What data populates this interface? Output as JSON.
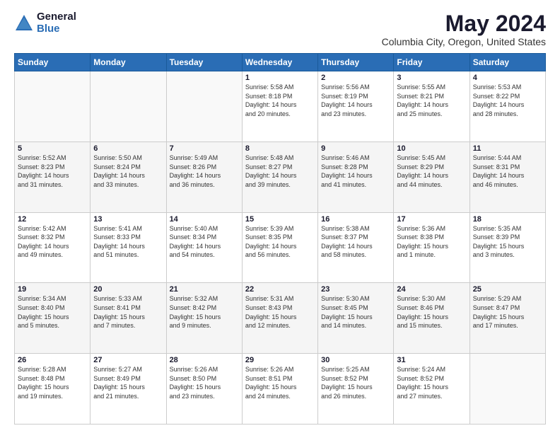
{
  "logo": {
    "general": "General",
    "blue": "Blue"
  },
  "title": "May 2024",
  "location": "Columbia City, Oregon, United States",
  "days_header": [
    "Sunday",
    "Monday",
    "Tuesday",
    "Wednesday",
    "Thursday",
    "Friday",
    "Saturday"
  ],
  "weeks": [
    [
      {
        "day": "",
        "info": ""
      },
      {
        "day": "",
        "info": ""
      },
      {
        "day": "",
        "info": ""
      },
      {
        "day": "1",
        "info": "Sunrise: 5:58 AM\nSunset: 8:18 PM\nDaylight: 14 hours\nand 20 minutes."
      },
      {
        "day": "2",
        "info": "Sunrise: 5:56 AM\nSunset: 8:19 PM\nDaylight: 14 hours\nand 23 minutes."
      },
      {
        "day": "3",
        "info": "Sunrise: 5:55 AM\nSunset: 8:21 PM\nDaylight: 14 hours\nand 25 minutes."
      },
      {
        "day": "4",
        "info": "Sunrise: 5:53 AM\nSunset: 8:22 PM\nDaylight: 14 hours\nand 28 minutes."
      }
    ],
    [
      {
        "day": "5",
        "info": "Sunrise: 5:52 AM\nSunset: 8:23 PM\nDaylight: 14 hours\nand 31 minutes."
      },
      {
        "day": "6",
        "info": "Sunrise: 5:50 AM\nSunset: 8:24 PM\nDaylight: 14 hours\nand 33 minutes."
      },
      {
        "day": "7",
        "info": "Sunrise: 5:49 AM\nSunset: 8:26 PM\nDaylight: 14 hours\nand 36 minutes."
      },
      {
        "day": "8",
        "info": "Sunrise: 5:48 AM\nSunset: 8:27 PM\nDaylight: 14 hours\nand 39 minutes."
      },
      {
        "day": "9",
        "info": "Sunrise: 5:46 AM\nSunset: 8:28 PM\nDaylight: 14 hours\nand 41 minutes."
      },
      {
        "day": "10",
        "info": "Sunrise: 5:45 AM\nSunset: 8:29 PM\nDaylight: 14 hours\nand 44 minutes."
      },
      {
        "day": "11",
        "info": "Sunrise: 5:44 AM\nSunset: 8:31 PM\nDaylight: 14 hours\nand 46 minutes."
      }
    ],
    [
      {
        "day": "12",
        "info": "Sunrise: 5:42 AM\nSunset: 8:32 PM\nDaylight: 14 hours\nand 49 minutes."
      },
      {
        "day": "13",
        "info": "Sunrise: 5:41 AM\nSunset: 8:33 PM\nDaylight: 14 hours\nand 51 minutes."
      },
      {
        "day": "14",
        "info": "Sunrise: 5:40 AM\nSunset: 8:34 PM\nDaylight: 14 hours\nand 54 minutes."
      },
      {
        "day": "15",
        "info": "Sunrise: 5:39 AM\nSunset: 8:35 PM\nDaylight: 14 hours\nand 56 minutes."
      },
      {
        "day": "16",
        "info": "Sunrise: 5:38 AM\nSunset: 8:37 PM\nDaylight: 14 hours\nand 58 minutes."
      },
      {
        "day": "17",
        "info": "Sunrise: 5:36 AM\nSunset: 8:38 PM\nDaylight: 15 hours\nand 1 minute."
      },
      {
        "day": "18",
        "info": "Sunrise: 5:35 AM\nSunset: 8:39 PM\nDaylight: 15 hours\nand 3 minutes."
      }
    ],
    [
      {
        "day": "19",
        "info": "Sunrise: 5:34 AM\nSunset: 8:40 PM\nDaylight: 15 hours\nand 5 minutes."
      },
      {
        "day": "20",
        "info": "Sunrise: 5:33 AM\nSunset: 8:41 PM\nDaylight: 15 hours\nand 7 minutes."
      },
      {
        "day": "21",
        "info": "Sunrise: 5:32 AM\nSunset: 8:42 PM\nDaylight: 15 hours\nand 9 minutes."
      },
      {
        "day": "22",
        "info": "Sunrise: 5:31 AM\nSunset: 8:43 PM\nDaylight: 15 hours\nand 12 minutes."
      },
      {
        "day": "23",
        "info": "Sunrise: 5:30 AM\nSunset: 8:45 PM\nDaylight: 15 hours\nand 14 minutes."
      },
      {
        "day": "24",
        "info": "Sunrise: 5:30 AM\nSunset: 8:46 PM\nDaylight: 15 hours\nand 15 minutes."
      },
      {
        "day": "25",
        "info": "Sunrise: 5:29 AM\nSunset: 8:47 PM\nDaylight: 15 hours\nand 17 minutes."
      }
    ],
    [
      {
        "day": "26",
        "info": "Sunrise: 5:28 AM\nSunset: 8:48 PM\nDaylight: 15 hours\nand 19 minutes."
      },
      {
        "day": "27",
        "info": "Sunrise: 5:27 AM\nSunset: 8:49 PM\nDaylight: 15 hours\nand 21 minutes."
      },
      {
        "day": "28",
        "info": "Sunrise: 5:26 AM\nSunset: 8:50 PM\nDaylight: 15 hours\nand 23 minutes."
      },
      {
        "day": "29",
        "info": "Sunrise: 5:26 AM\nSunset: 8:51 PM\nDaylight: 15 hours\nand 24 minutes."
      },
      {
        "day": "30",
        "info": "Sunrise: 5:25 AM\nSunset: 8:52 PM\nDaylight: 15 hours\nand 26 minutes."
      },
      {
        "day": "31",
        "info": "Sunrise: 5:24 AM\nSunset: 8:52 PM\nDaylight: 15 hours\nand 27 minutes."
      },
      {
        "day": "",
        "info": ""
      }
    ]
  ]
}
